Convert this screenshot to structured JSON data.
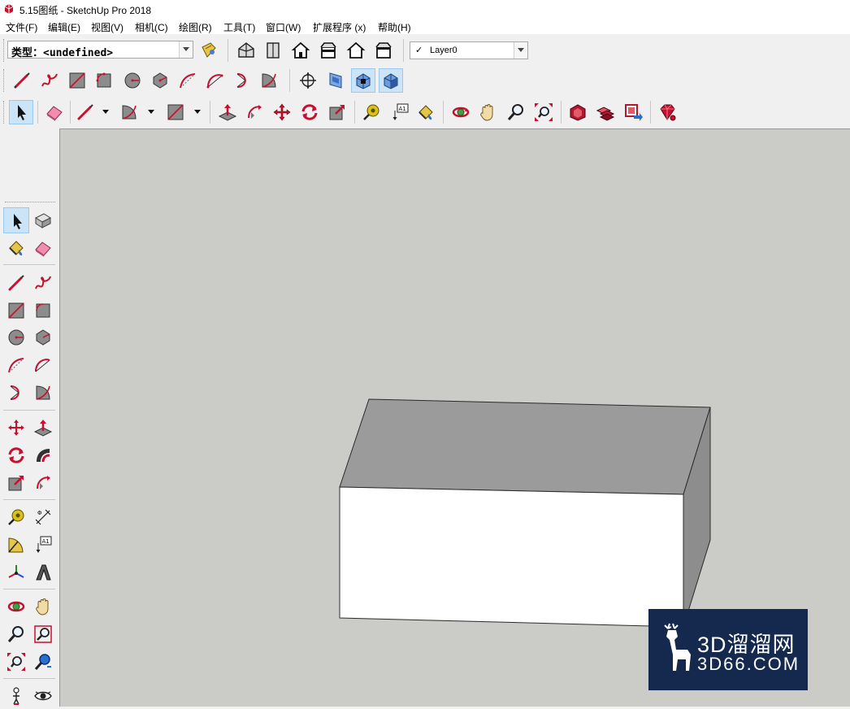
{
  "window": {
    "title": "5.15图纸 - SketchUp Pro 2018"
  },
  "menu": [
    {
      "id": "file",
      "label": "文件(F)"
    },
    {
      "id": "edit",
      "label": "编辑(E)"
    },
    {
      "id": "view",
      "label": "视图(V)"
    },
    {
      "id": "camera",
      "label": "相机(C)"
    },
    {
      "id": "draw",
      "label": "绘图(R)"
    },
    {
      "id": "tools",
      "label": "工具(T)"
    },
    {
      "id": "window",
      "label": "窗口(W)"
    },
    {
      "id": "extensions",
      "label": "扩展程序 (x)"
    },
    {
      "id": "help",
      "label": "帮助(H)"
    }
  ],
  "style_selector": {
    "value": "类型：<undefined>"
  },
  "layer_selector": {
    "checked": true,
    "value": "Layer0"
  },
  "icons": {
    "views": [
      "iso-view-icon",
      "top-view-icon",
      "front-view-icon",
      "right-view-icon",
      "back-view-icon",
      "left-view-icon"
    ],
    "draw": [
      "line-icon",
      "freehand-icon",
      "rectangle-icon",
      "rotated-rectangle-icon",
      "circle-icon",
      "polygon-icon",
      "arc-icon",
      "two-point-arc-icon",
      "three-point-arc-icon",
      "pie-icon"
    ],
    "section": [
      "section-plane-icon",
      "display-section-planes-icon",
      "display-section-cuts-icon",
      "section-fill-icon"
    ]
  },
  "colors": {
    "accent_red": "#c8102e",
    "viewport_bg": "#cbcbc8",
    "selected_tool_bg": "#cce4f7",
    "watermark_bg": "#15294f"
  },
  "watermark": {
    "title": "3D溜溜网",
    "subtitle": "3D66.COM"
  }
}
